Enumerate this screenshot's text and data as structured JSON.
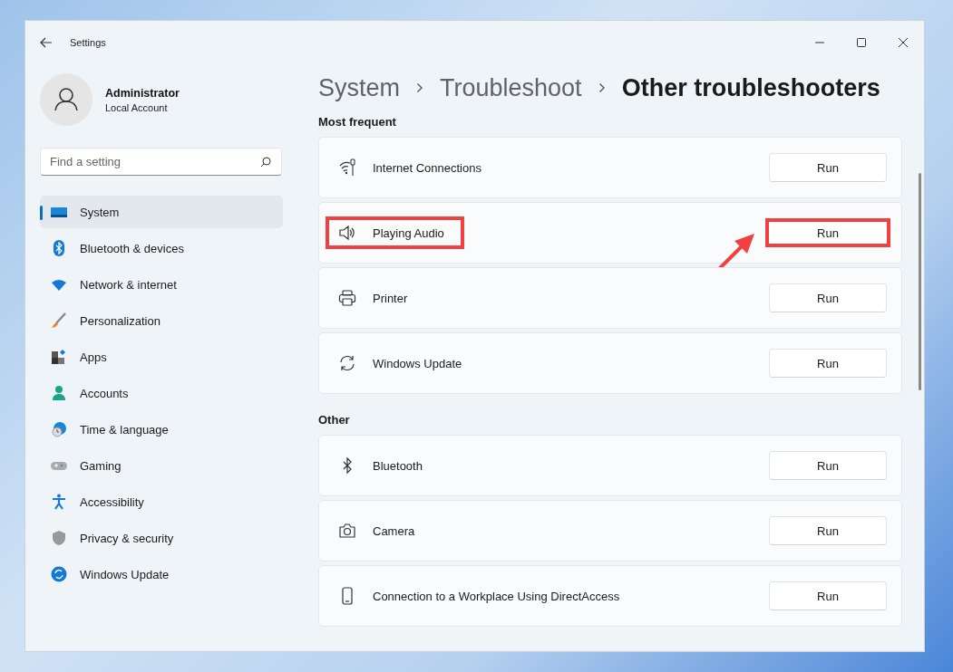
{
  "window": {
    "title": "Settings"
  },
  "account": {
    "name": "Administrator",
    "type": "Local Account"
  },
  "search": {
    "placeholder": "Find a setting"
  },
  "nav": [
    {
      "label": "System",
      "kind": "system",
      "selected": true
    },
    {
      "label": "Bluetooth & devices",
      "kind": "bluetooth",
      "selected": false
    },
    {
      "label": "Network & internet",
      "kind": "wifi",
      "selected": false
    },
    {
      "label": "Personalization",
      "kind": "brush",
      "selected": false
    },
    {
      "label": "Apps",
      "kind": "apps",
      "selected": false
    },
    {
      "label": "Accounts",
      "kind": "person",
      "selected": false
    },
    {
      "label": "Time & language",
      "kind": "clock",
      "selected": false
    },
    {
      "label": "Gaming",
      "kind": "gamepad",
      "selected": false
    },
    {
      "label": "Accessibility",
      "kind": "accessibility",
      "selected": false
    },
    {
      "label": "Privacy & security",
      "kind": "shield",
      "selected": false
    },
    {
      "label": "Windows Update",
      "kind": "update",
      "selected": false
    }
  ],
  "breadcrumb": [
    "System",
    "Troubleshoot",
    "Other troubleshooters"
  ],
  "sections": [
    {
      "title": "Most frequent",
      "items": [
        {
          "label": "Internet Connections",
          "kind": "wifi",
          "button": "Run",
          "highlighted": false
        },
        {
          "label": "Playing Audio",
          "kind": "speaker",
          "button": "Run",
          "highlighted": true
        },
        {
          "label": "Printer",
          "kind": "printer",
          "button": "Run",
          "highlighted": false
        },
        {
          "label": "Windows Update",
          "kind": "sync",
          "button": "Run",
          "highlighted": false
        }
      ]
    },
    {
      "title": "Other",
      "items": [
        {
          "label": "Bluetooth",
          "kind": "bluetooth",
          "button": "Run",
          "highlighted": false
        },
        {
          "label": "Camera",
          "kind": "camera",
          "button": "Run",
          "highlighted": false
        },
        {
          "label": "Connection to a Workplace Using DirectAccess",
          "kind": "phone",
          "button": "Run",
          "highlighted": false
        }
      ]
    }
  ]
}
